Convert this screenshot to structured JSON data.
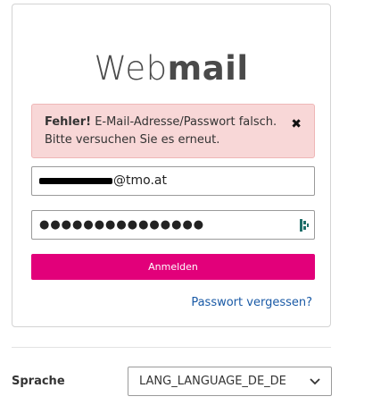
{
  "logo": {
    "light": "Web",
    "bold": "mail"
  },
  "alert": {
    "title": "Fehler!",
    "message": "E-Mail-Adresse/Passwort falsch. Bitte versuchen Sie es erneut.",
    "close_icon": "close-icon"
  },
  "email": {
    "visible_suffix": "@tmo.at"
  },
  "password": {
    "masked": "●●●●●●●●●●●●●●●",
    "icon": "password-manager-icon"
  },
  "submit_label": "Anmelden",
  "forgot_link": "Passwort vergessen?",
  "language": {
    "label": "Sprache",
    "selected": "LANG_LANGUAGE_DE_DE"
  },
  "colors": {
    "accent": "#e2007a",
    "link": "#1a5aa6",
    "alert_bg": "#f8d7d7"
  }
}
